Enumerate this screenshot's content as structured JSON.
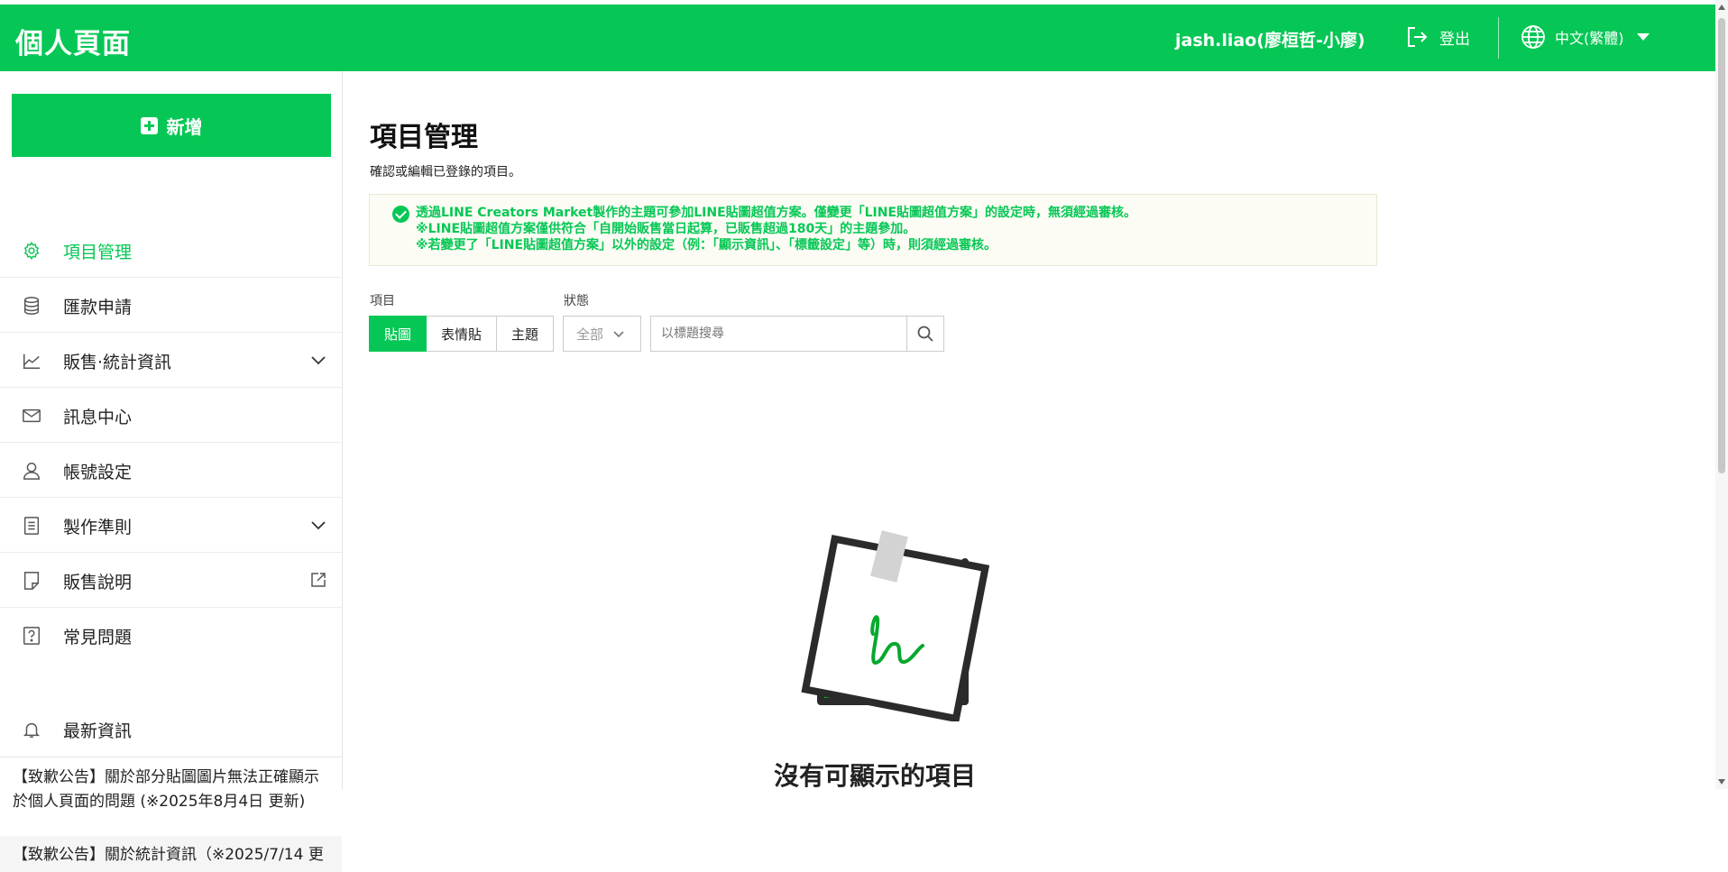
{
  "header": {
    "title": "個人頁面",
    "user": "jash.liao(廖桓哲-小廖)",
    "logout_label": "登出",
    "language": "中文(繁體)",
    "brand_color": "#06c755"
  },
  "sidebar": {
    "add_label": "新增",
    "items": [
      {
        "label": "項目管理",
        "icon": "gear-icon",
        "active": true
      },
      {
        "label": "匯款申請",
        "icon": "database-icon"
      },
      {
        "label": "販售‧統計資訊",
        "icon": "chart-icon",
        "expandable": true
      },
      {
        "label": "訊息中心",
        "icon": "mail-icon"
      },
      {
        "label": "帳號設定",
        "icon": "user-icon"
      },
      {
        "label": "製作準則",
        "icon": "document-icon",
        "expandable": true
      },
      {
        "label": "販售說明",
        "icon": "note-icon",
        "external": true
      },
      {
        "label": "常見問題",
        "icon": "question-icon"
      }
    ],
    "news": {
      "label": "最新資訊",
      "items": [
        "【致歉公告】關於部分貼圖圖片無法正確顯示於個人頁面的問題 (※2025年8月4日 更新)",
        "【致歉公告】關於統計資訊（※2025/7/14 更"
      ]
    }
  },
  "main": {
    "title": "項目管理",
    "subtitle": "確認或編輯已登錄的項目。",
    "notice": {
      "line1": "透過LINE Creators Market製作的主題可參加LINE貼圖超值方案。僅變更「LINE貼圖超值方案」的設定時，無須經過審核。",
      "line2": "※LINE貼圖超值方案僅供符合「自開始販售當日起算，已販售超過180天」的主題參加。",
      "line3": "※若變更了「LINE貼圖超值方案」以外的設定（例：「顯示資訊」、「標籤設定」等）時，則須經過審核。"
    },
    "filters": {
      "item_label": "項目",
      "status_label": "狀態",
      "tabs": [
        {
          "label": "貼圖",
          "selected": true
        },
        {
          "label": "表情貼"
        },
        {
          "label": "主題"
        }
      ],
      "status_value": "全部",
      "search_placeholder": "以標題搜尋"
    },
    "empty_text": "沒有可顯示的項目"
  }
}
